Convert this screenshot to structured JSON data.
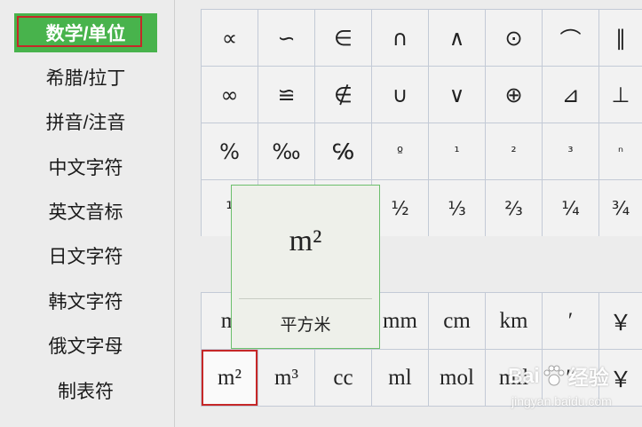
{
  "sidebar": {
    "items": [
      {
        "label": "数学/单位",
        "active": true
      },
      {
        "label": "希腊/拉丁"
      },
      {
        "label": "拼音/注音"
      },
      {
        "label": "中文字符"
      },
      {
        "label": "英文音标"
      },
      {
        "label": "日文字符"
      },
      {
        "label": "韩文字符"
      },
      {
        "label": "俄文字母"
      },
      {
        "label": "制表符"
      }
    ]
  },
  "math_symbols": {
    "rows": [
      [
        "∝",
        "∽",
        "∈",
        "∩",
        "∧",
        "⊙",
        "⌒",
        "∥"
      ],
      [
        "∞",
        "≌",
        "∉",
        "∪",
        "∨",
        "⊕",
        "⊿",
        "⊥"
      ],
      [
        "%",
        "‰",
        "℅",
        "º",
        "¹",
        "²",
        "³",
        "ⁿ"
      ],
      [
        "¹",
        "",
        "",
        "½",
        "⅓",
        "⅔",
        "¼",
        "¾"
      ]
    ]
  },
  "unit_symbols": {
    "rows": [
      [
        "m",
        "",
        "",
        "mm",
        "cm",
        "km",
        "′",
        "￥"
      ],
      [
        "m²",
        "m³",
        "cc",
        "ml",
        "mol",
        "mil",
        "″",
        "￥"
      ]
    ]
  },
  "tooltip": {
    "symbol": "m²",
    "name": "平方米"
  },
  "watermark": {
    "brand_left": "Bai",
    "brand_right": "经验",
    "url": "jingyan.baidu.com"
  },
  "colors": {
    "accent_green": "#48b34c",
    "selection_red": "#c62828",
    "grid_line": "#c3cad6",
    "tooltip_border": "#6cbf6c"
  }
}
